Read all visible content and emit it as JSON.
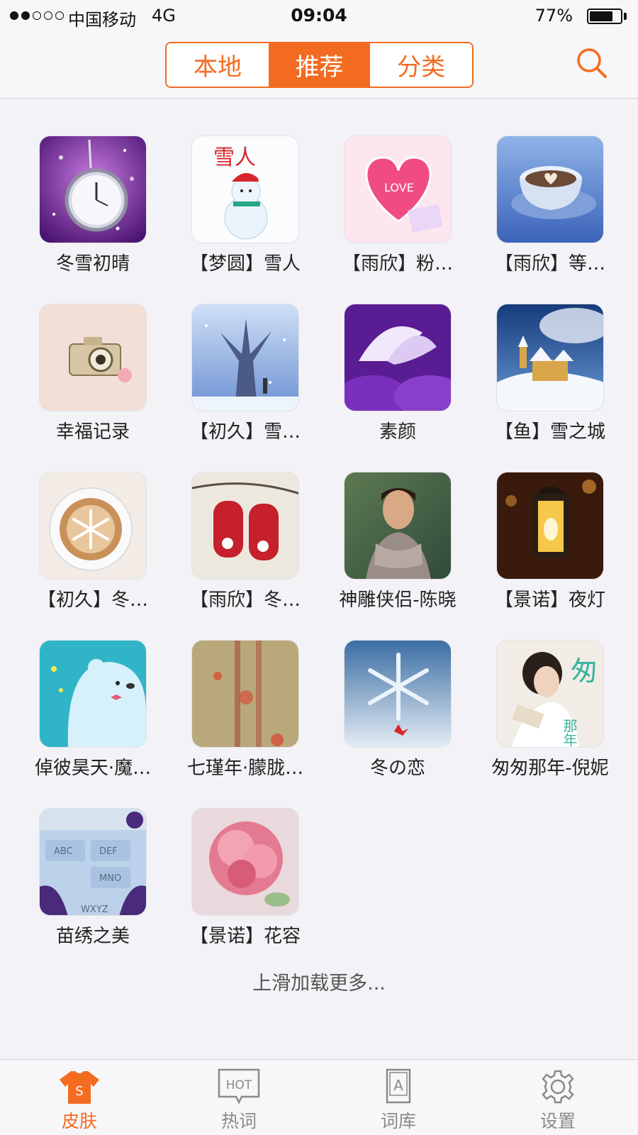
{
  "status_bar": {
    "carrier": "中国移动",
    "network": "4G",
    "time": "09:04",
    "battery_pct": "77%",
    "battery_level": 0.77,
    "signal_bars": 2
  },
  "header": {
    "tabs": [
      {
        "label": "本地",
        "active": false
      },
      {
        "label": "推荐",
        "active": true
      },
      {
        "label": "分类",
        "active": false
      }
    ],
    "search_icon": "search-icon"
  },
  "accent_color": "#f36b21",
  "skins": [
    {
      "label": "冬雪初晴",
      "art": "pocket-watch"
    },
    {
      "label": "【梦圆】雪人",
      "art": "snowman"
    },
    {
      "label": "【雨欣】粉…",
      "art": "pink-heart"
    },
    {
      "label": "【雨欣】等…",
      "art": "coffee-cup"
    },
    {
      "label": "幸福记录",
      "art": "camera"
    },
    {
      "label": "【初久】雪…",
      "art": "snow-tree"
    },
    {
      "label": "素颜",
      "art": "purple-flower"
    },
    {
      "label": "【鱼】雪之城",
      "art": "snow-castle"
    },
    {
      "label": "【初久】冬…",
      "art": "latte"
    },
    {
      "label": "【雨欣】冬…",
      "art": "red-mittens"
    },
    {
      "label": "神雕侠侣-陈晓",
      "art": "portrait-man"
    },
    {
      "label": "【景诺】夜灯",
      "art": "lantern"
    },
    {
      "label": "倬彼昊天·魔…",
      "art": "blue-bear"
    },
    {
      "label": "七瑾年·朦胧…",
      "art": "blur-lights"
    },
    {
      "label": "冬の恋",
      "art": "snowflake"
    },
    {
      "label": "匆匆那年-倪妮",
      "art": "reading-girl"
    },
    {
      "label": "苗绣之美",
      "art": "keyboard-preview"
    },
    {
      "label": "【景诺】花容",
      "art": "carnation"
    }
  ],
  "keyboard_preview_keys": [
    "ABC",
    "DEF",
    "MNO",
    "WXYZ"
  ],
  "artwork_text": {
    "snowman_title": "雪人",
    "heart_text": "LOVE",
    "reading_girl_title": "匆",
    "reading_girl_subtitle": "那年"
  },
  "load_more": "上滑加载更多...",
  "tabbar": [
    {
      "label": "皮肤",
      "icon": "shirt-icon",
      "active": true
    },
    {
      "label": "热词",
      "icon": "hot-icon",
      "active": false
    },
    {
      "label": "词库",
      "icon": "dictionary-icon",
      "active": false
    },
    {
      "label": "设置",
      "icon": "gear-icon",
      "active": false
    }
  ],
  "tab_icon_text": {
    "skin": "S",
    "hot": "HOT",
    "dict": "A"
  }
}
